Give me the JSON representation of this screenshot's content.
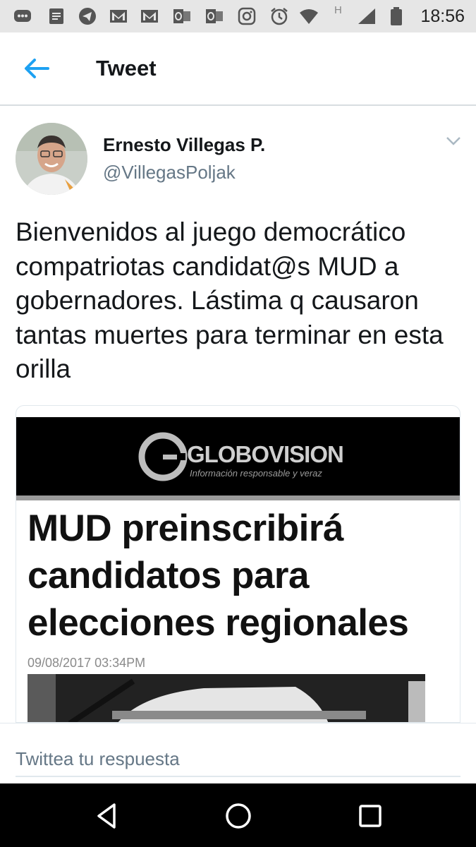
{
  "status_bar": {
    "time": "18:56",
    "network_letter": "H",
    "icons": [
      "messages-icon",
      "document-icon",
      "telegram-icon",
      "gmail-icon",
      "gmail-icon",
      "outlook-icon",
      "outlook-icon",
      "instagram-icon",
      "alarm-icon",
      "wifi-icon",
      "signal-icon",
      "battery-icon"
    ]
  },
  "header": {
    "title": "Tweet",
    "back_icon": "arrow-left-icon"
  },
  "tweet": {
    "author_name": "Ernesto Villegas P.",
    "author_handle": "@VillegasPoljak",
    "text": "Bienvenidos al juego democrático compatriotas candidat@s MUD a gobernadores. Lástima q causaron tantas muertes para terminar en esta orilla",
    "menu_icon": "chevron-down-icon"
  },
  "media": {
    "brand": "GLOBOVISION",
    "tagline": "Información responsable y veraz",
    "headline": "MUD preinscribirá candidatos para elecciones regionales",
    "date": "09/08/2017 03:34PM"
  },
  "reply": {
    "placeholder": "Twittea tu respuesta"
  },
  "colors": {
    "accent": "#1da1f2",
    "text": "#14171a",
    "secondary": "#657786",
    "status_bar_bg": "#e6e6e6",
    "nav_bg": "#000000"
  },
  "nav": {
    "icons": [
      "back-triangle-icon",
      "home-circle-icon",
      "recents-square-icon"
    ]
  }
}
